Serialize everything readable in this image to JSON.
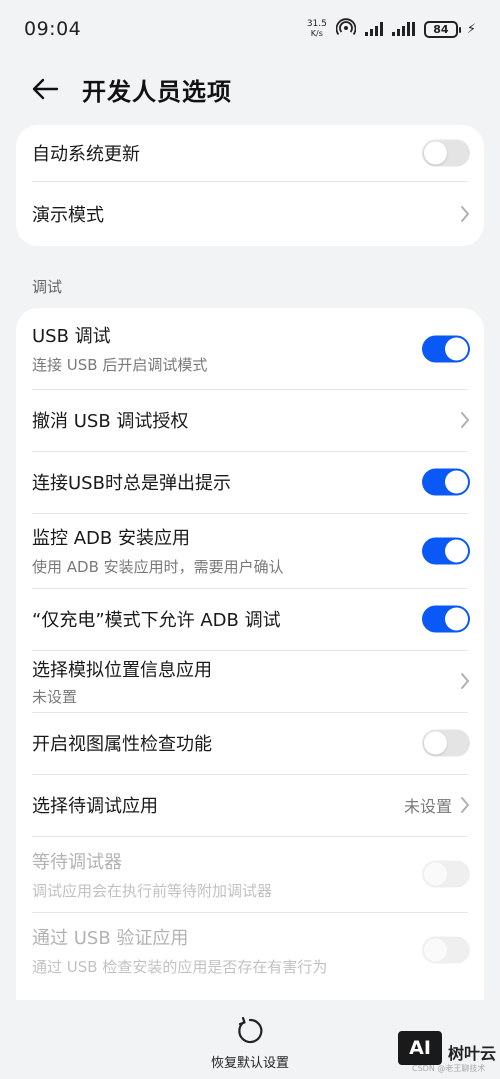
{
  "status_bar": {
    "time": "09:04",
    "net_speed_value": "31.5",
    "net_speed_unit": "K/s",
    "battery": "84"
  },
  "header": {
    "title": "开发人员选项"
  },
  "top_group": {
    "items": [
      {
        "title": "自动系统更新",
        "control": "toggle",
        "state": "off"
      },
      {
        "title": "演示模式",
        "control": "chevron"
      }
    ]
  },
  "debug_section": {
    "label": "调试",
    "items": [
      {
        "title": "USB 调试",
        "subtitle": "连接 USB 后开启调试模式",
        "control": "toggle",
        "state": "on"
      },
      {
        "title": "撤消 USB 调试授权",
        "control": "chevron"
      },
      {
        "title": "连接USB时总是弹出提示",
        "control": "toggle",
        "state": "on"
      },
      {
        "title": "监控 ADB 安装应用",
        "subtitle": "使用 ADB 安装应用时，需要用户确认",
        "control": "toggle",
        "state": "on"
      },
      {
        "title": "“仅充电”模式下允许 ADB 调试",
        "control": "toggle",
        "state": "on"
      },
      {
        "title": "选择模拟位置信息应用",
        "subtitle": "未设置",
        "control": "chevron"
      },
      {
        "title": "开启视图属性检查功能",
        "control": "toggle",
        "state": "off"
      },
      {
        "title": "选择待调试应用",
        "value": "未设置",
        "control": "chevron"
      },
      {
        "title": "等待调试器",
        "subtitle": "调试应用会在执行前等待附加调试器",
        "control": "toggle",
        "state": "off",
        "disabled": true
      },
      {
        "title": "通过 USB 验证应用",
        "subtitle": "通过 USB 检查安装的应用是否存在有害行为",
        "control": "toggle",
        "state": "off",
        "disabled": true
      }
    ]
  },
  "bottom_bar": {
    "restore_label": "恢复默认设置"
  },
  "watermark": {
    "logo_text": "AI",
    "brand": "树叶云",
    "credit": "CSDN @老王聊技术"
  },
  "colors": {
    "accent": "#0a59f7",
    "background": "#f1f3f5",
    "card": "#ffffff"
  }
}
